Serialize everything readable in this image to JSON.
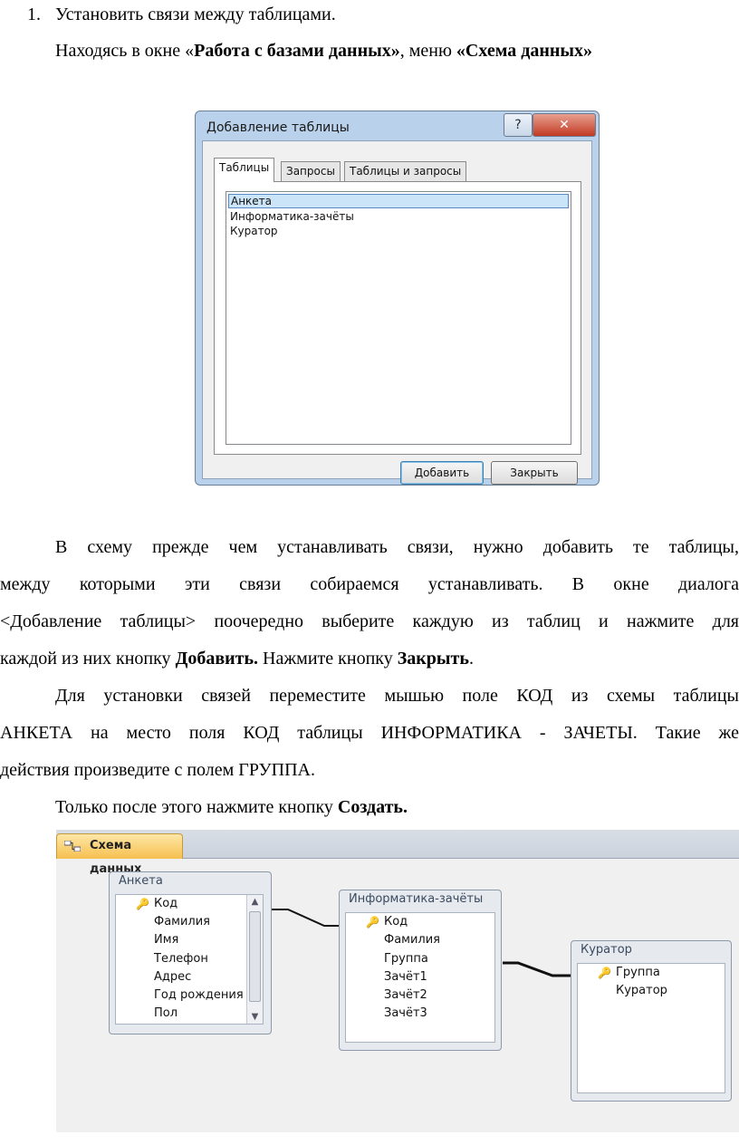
{
  "doc": {
    "item1_number": "1.",
    "item1_text": "Установить связи между таблицами.",
    "line2_prefix": "Находясь в окне «",
    "line2_bold1": "Работа с базами данных»",
    "line2_mid": ", меню ",
    "line2_bold2": "«Схема данных»",
    "para1_line1": "В схему прежде чем устанавливать связи, нужно добавить те таблицы,",
    "para1_line2": "между которыми эти связи собираемся устанавливать. В окне диалога",
    "para1_line3": "<Добавление таблицы> поочередно выберите каждую из таблиц и нажмите для",
    "para1_line4_a": "каждой из них кнопку ",
    "para1_line4_b": "Добавить.",
    "para1_line4_c": " Нажмите кнопку ",
    "para1_line4_d": "Закрыть",
    "para1_line4_e": ".",
    "para2_line1": "Для установки связей переместите мышью поле КОД из схемы таблицы",
    "para2_line2": "АНКЕТА на место поля КОД таблицы ИНФОРМАТИКА - ЗАЧЕТЫ. Такие же",
    "para2_line3": "действия произведите с полем ГРУППА.",
    "para3_a": "Только после этого нажмите кнопку ",
    "para3_b": "Создать."
  },
  "dialog": {
    "title": "Добавление таблицы",
    "help_glyph": "?",
    "close_glyph": "✕",
    "tabs": [
      "Таблицы",
      "Запросы",
      "Таблицы и запросы"
    ],
    "items": [
      "Анкета",
      "Информатика-зачёты",
      "Куратор"
    ],
    "selected_item": "Анкета",
    "add_button": "Добавить",
    "close_button": "Закрыть"
  },
  "schema": {
    "tab_label": "Схема данных",
    "tables": [
      {
        "name": "Анкета",
        "fields": [
          "Код",
          "Фамилия",
          "Имя",
          "Телефон",
          "Адрес",
          "Год рождения",
          "Пол"
        ],
        "key": "Код"
      },
      {
        "name": "Информатика-зачёты",
        "fields": [
          "Код",
          "Фамилия",
          "Группа",
          "Зачёт1",
          "Зачёт2",
          "Зачёт3"
        ],
        "key": "Код"
      },
      {
        "name": "Куратор",
        "fields": [
          "Группа",
          "Куратор"
        ],
        "key": "Группа"
      }
    ],
    "key_icon": "key-icon",
    "colors": {
      "tab_accent": "#f6c04f",
      "dialog_frame": "#b9d1ea",
      "selection": "#cce4f7"
    }
  }
}
